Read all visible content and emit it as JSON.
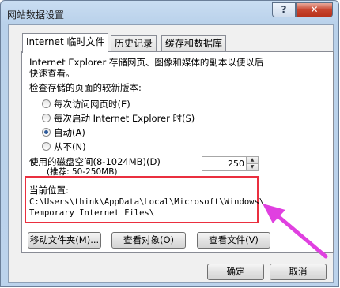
{
  "window": {
    "title": "网站数据设置",
    "help": "?",
    "close": "✕"
  },
  "tabs": [
    {
      "label": "Internet 临时文件"
    },
    {
      "label": "历史记录"
    },
    {
      "label": "缓存和数据库"
    }
  ],
  "panel": {
    "description_line1": "Internet Explorer 存储网页、图像和媒体的副本以便以后",
    "description_line2": "快速查看。",
    "check_label": "检查存储的页面的较新版本:",
    "options": [
      {
        "label": "每次访问网页时(E)",
        "selected": false
      },
      {
        "label": "每次启动 Internet Explorer 时(S)",
        "selected": false
      },
      {
        "label": "自动(A)",
        "selected": true
      },
      {
        "label": "从不(N)",
        "selected": false
      }
    ],
    "disk_space_label": "使用的磁盘空间(8-1024MB)(D)",
    "disk_space_hint": "(推荐: 50-250MB)",
    "disk_space_value": "250",
    "location_label": "当前位置:",
    "location_path_line1": "C:\\Users\\think\\AppData\\Local\\Microsoft\\Windows\\",
    "location_path_line2": "Temporary Internet Files\\"
  },
  "buttons": {
    "move_folder": "移动文件夹(M)...",
    "view_objects": "查看对象(O)",
    "view_files": "查看文件(V)",
    "ok": "确定",
    "cancel": "取消"
  },
  "colors": {
    "highlight_box": "#ea2f3f",
    "arrow": "#e040e0"
  }
}
